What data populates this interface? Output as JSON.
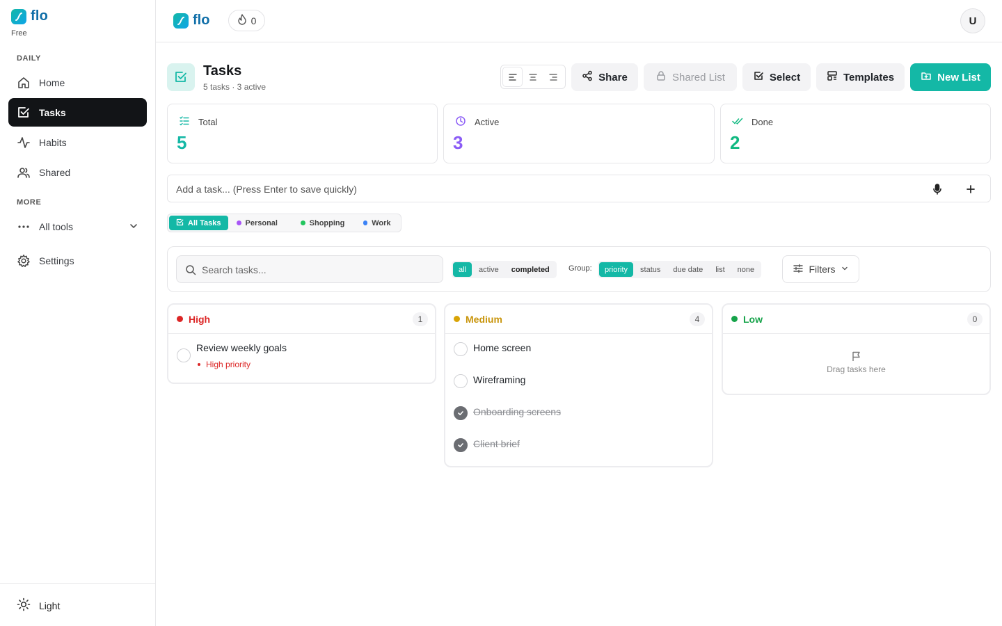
{
  "app": {
    "name": "flo",
    "plan": "Free"
  },
  "sidebar": {
    "sections": {
      "daily": "DAILY",
      "more": "MORE"
    },
    "items": [
      {
        "label": "Home",
        "icon": "home-icon"
      },
      {
        "label": "Tasks",
        "icon": "checkbox-icon",
        "active": true
      },
      {
        "label": "Habits",
        "icon": "activity-icon"
      },
      {
        "label": "Shared",
        "icon": "users-icon"
      }
    ],
    "all_tools": "All tools",
    "settings": "Settings",
    "theme": "Light"
  },
  "header": {
    "streak_count": "0",
    "avatar_initial": "U"
  },
  "page": {
    "title": "Tasks",
    "subtitle": "5 tasks · 3 active",
    "buttons": {
      "share": "Share",
      "shared_list": "Shared List",
      "select": "Select",
      "templates": "Templates",
      "new_list": "New List"
    }
  },
  "stats": [
    {
      "label": "Total",
      "value": "5",
      "color": "#14b8a6"
    },
    {
      "label": "Active",
      "value": "3",
      "color": "#8b5cf6"
    },
    {
      "label": "Done",
      "value": "2",
      "color": "#10b981"
    }
  ],
  "add_task": {
    "placeholder": "Add a task... (Press Enter to save quickly)"
  },
  "lists": [
    {
      "label": "All Tasks",
      "active": true
    },
    {
      "label": "Personal",
      "color": "#a855f7"
    },
    {
      "label": "Shopping",
      "color": "#22c55e"
    },
    {
      "label": "Work",
      "color": "#3b82f6"
    }
  ],
  "filters": {
    "search_placeholder": "Search tasks...",
    "status": [
      "all",
      "active",
      "completed"
    ],
    "group_label": "Group:",
    "group": [
      "priority",
      "status",
      "due date",
      "list",
      "none"
    ],
    "filters_label": "Filters"
  },
  "columns": [
    {
      "title": "High",
      "count": "1",
      "color": "#dc2626",
      "tasks": [
        {
          "title": "Review weekly goals",
          "done": false,
          "badge": "High priority"
        }
      ]
    },
    {
      "title": "Medium",
      "count": "4",
      "color": "#d9a406",
      "tasks": [
        {
          "title": "Home screen",
          "done": false
        },
        {
          "title": "Wireframing",
          "done": false
        },
        {
          "title": "Onboarding screens",
          "done": true
        },
        {
          "title": "Client brief",
          "done": true
        }
      ]
    },
    {
      "title": "Low",
      "count": "0",
      "color": "#16a34a",
      "tasks": [],
      "empty_text": "Drag tasks here"
    }
  ]
}
